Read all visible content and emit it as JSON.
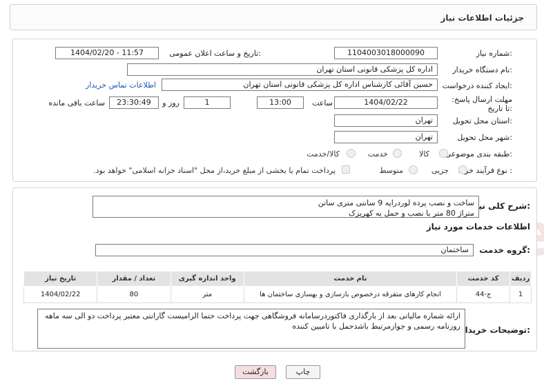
{
  "header": {
    "title": "جزئیات اطلاعات نیاز"
  },
  "form": {
    "need_number_label": "شماره نیاز:",
    "need_number": "1104003018000090",
    "announce_label": "تاریخ و ساعت اعلان عمومی:",
    "announce_value": "1404/02/20 - 11:57",
    "buyer_label": "نام دستگاه خریدار:",
    "buyer_value": "اداره کل پزشکی قانونی استان تهران",
    "creator_label": "ایجاد کننده درخواست:",
    "creator_value": "حسین آقائی کارشناس اداره کل پزشکی قانونی استان تهران",
    "contact_link": "اطلاعات تماس خریدار",
    "deadline_label": "مهلت ارسال پاسخ: تا تاریخ:",
    "deadline_date": "1404/02/22",
    "time_label": "ساعت",
    "deadline_time": "13:00",
    "days_value": "1",
    "days_label": "روز و",
    "remaining_time": "23:30:49",
    "remaining_label": "ساعت باقی مانده",
    "province_label": "استان محل تحویل:",
    "province_value": "تهران",
    "city_label": "شهر محل تحویل:",
    "city_value": "تهران",
    "category_label": "طبقه بندی موضوعی:",
    "category_options": [
      "کالا",
      "خدمت",
      "کالا/خدمت"
    ],
    "process_label": "نوع فرآیند خرید :",
    "process_options": [
      "جزیی",
      "متوسط"
    ],
    "payment_note": "پرداخت تمام یا بخشی از مبلغ خرید،از محل \"اسناد خزانه اسلامی\" خواهد بود."
  },
  "details": {
    "summary_label": "شرح کلی نیاز:",
    "summary_line1": "ساخت و نصب پرده لوردراپه 9 سانتی متری ساتن",
    "summary_line2": "متراژ 80 متر با نصب و حمل به کهریزک",
    "services_heading": "اطلاعات خدمات مورد نیاز",
    "group_label": "گروه خدمت:",
    "group_value": "ساختمان",
    "table_headers": [
      "ردیف",
      "کد خدمت",
      "نام خدمت",
      "واحد اندازه گیری",
      "تعداد / مقدار",
      "تاریخ نیاز"
    ],
    "table_rows": [
      [
        "1",
        "ج-44",
        "انجام کارهای متفرقه درخصوص بازسازی و بهسازی ساختمان ها",
        "متر",
        "80",
        "1404/02/22"
      ]
    ],
    "buyer_notes_label": "توضیحات خریدار:",
    "buyer_notes": "ارائه شماره مالیاتی بعد از بارگذاری فاکتوردرسامانه فروشگاهی جهت پرداخت حتما الزامیست گارانتی معتبر پرداخت دو الی سه ماهه  روزنامه رسمی و جوازمرتبط باشدحمل با تامیین کننده"
  },
  "buttons": {
    "print": "چاپ",
    "back": "بازگشت"
  },
  "watermark": {
    "text": "AriaTender.neT"
  },
  "colors": {
    "link": "#1a57b8",
    "back_button_bg": "#f6dede",
    "header_bg": "#e3e3e3"
  }
}
